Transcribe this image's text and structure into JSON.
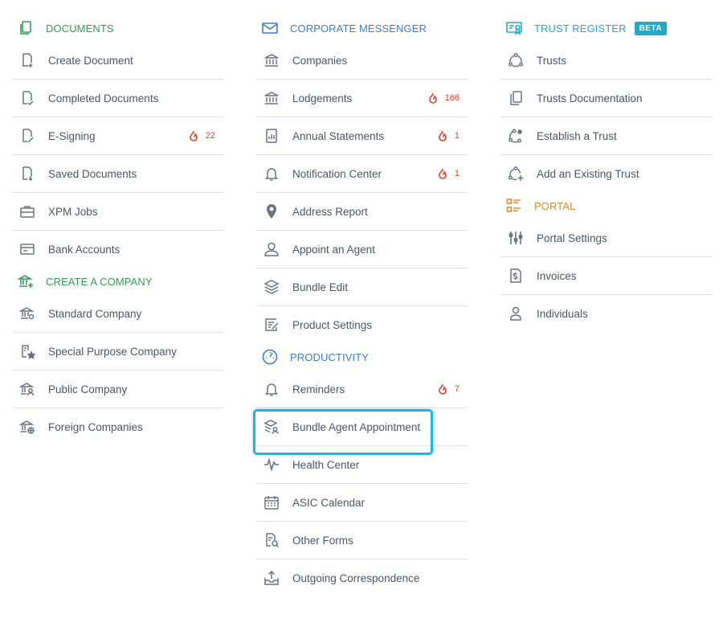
{
  "columns": [
    {
      "sections": [
        {
          "title": "DOCUMENTS",
          "color": "#2f9e55",
          "icon": "documents-icon",
          "items": [
            {
              "label": "Create Document",
              "icon": "create-document-icon"
            },
            {
              "label": "Completed Documents",
              "icon": "completed-documents-icon"
            },
            {
              "label": "E-Signing",
              "icon": "e-signing-icon",
              "count": "22"
            },
            {
              "label": "Saved Documents",
              "icon": "saved-documents-icon"
            },
            {
              "label": "XPM Jobs",
              "icon": "briefcase-icon"
            },
            {
              "label": "Bank Accounts",
              "icon": "bank-card-icon"
            }
          ]
        },
        {
          "title": "CREATE A COMPANY",
          "color": "#2f9e55",
          "icon": "create-company-icon",
          "items": [
            {
              "label": "Standard Company",
              "icon": "standard-company-icon"
            },
            {
              "label": "Special Purpose Company",
              "icon": "special-purpose-company-icon"
            },
            {
              "label": "Public Company",
              "icon": "public-company-icon"
            },
            {
              "label": "Foreign Companies",
              "icon": "foreign-companies-icon"
            }
          ]
        }
      ]
    },
    {
      "sections": [
        {
          "title": "CORPORATE MESSENGER",
          "color": "#3d7cc9",
          "icon": "envelope-icon",
          "items": [
            {
              "label": "Companies",
              "icon": "bank-building-icon"
            },
            {
              "label": "Lodgements",
              "icon": "bank-building-icon",
              "count": "166"
            },
            {
              "label": "Annual Statements",
              "icon": "statement-icon",
              "count": "1"
            },
            {
              "label": "Notification Center",
              "icon": "bell-icon",
              "count": "1"
            },
            {
              "label": "Address Report",
              "icon": "map-pin-icon"
            },
            {
              "label": "Appoint an Agent",
              "icon": "user-icon"
            },
            {
              "label": "Bundle Edit",
              "icon": "layers-icon"
            },
            {
              "label": "Product Settings",
              "icon": "edit-form-icon"
            }
          ]
        },
        {
          "title": "PRODUCTIVITY",
          "color": "#3d7cc9",
          "icon": "gauge-icon",
          "items": [
            {
              "label": "Reminders",
              "icon": "bell-icon",
              "count": "7"
            },
            {
              "label": "Bundle Agent Appointment",
              "icon": "layers-user-icon"
            },
            {
              "label": "Health Center",
              "icon": "pulse-icon"
            },
            {
              "label": "ASIC Calendar",
              "icon": "calendar-icon"
            },
            {
              "label": "Other Forms",
              "icon": "form-search-icon"
            },
            {
              "label": "Outgoing Correspondence",
              "icon": "outbox-icon"
            }
          ]
        }
      ]
    },
    {
      "sections": [
        {
          "title": "TRUST REGISTER",
          "color": "#26a9c7",
          "icon": "certificate-icon",
          "badge": "BETA",
          "items": [
            {
              "label": "Trusts",
              "icon": "trust-cycle-icon"
            },
            {
              "label": "Trusts Documentation",
              "icon": "documents-copy-icon"
            },
            {
              "label": "Establish a Trust",
              "icon": "trust-star-icon"
            },
            {
              "label": "Add an Existing Trust",
              "icon": "trust-add-icon"
            }
          ]
        },
        {
          "title": "PORTAL",
          "color": "#e08a2c",
          "icon": "portal-list-icon",
          "items": [
            {
              "label": "Portal Settings",
              "icon": "sliders-icon"
            },
            {
              "label": "Invoices",
              "icon": "invoice-icon"
            },
            {
              "label": "Individuals",
              "icon": "person-icon"
            }
          ]
        }
      ]
    }
  ],
  "highlighted_item": "Bundle Agent Appointment"
}
